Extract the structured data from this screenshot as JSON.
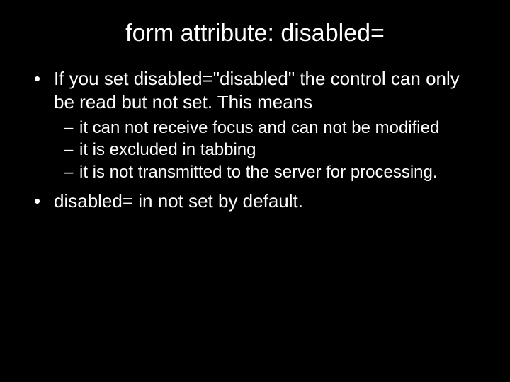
{
  "title": "form attribute: disabled=",
  "bullets": [
    {
      "text": "If you set disabled=\"disabled\" the control can only be read but not set. This means",
      "sub": [
        "it can not receive focus and can not be modified",
        "it is excluded in tabbing",
        "it is not transmitted to the server for processing."
      ]
    },
    {
      "text": "disabled= in not set by default.",
      "sub": []
    }
  ]
}
